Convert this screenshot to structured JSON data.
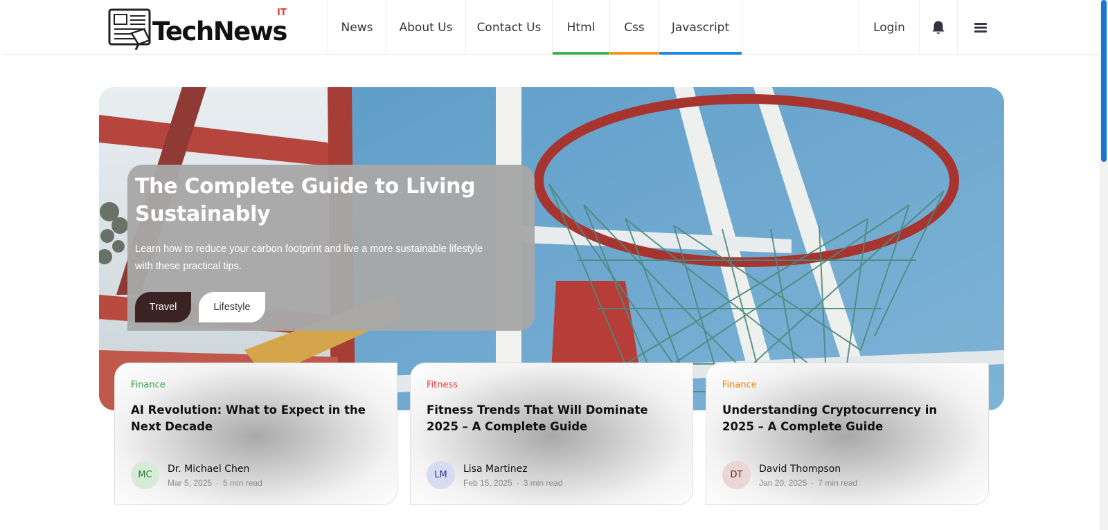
{
  "brand": {
    "name": "TechNews",
    "superscript": "IT"
  },
  "nav": {
    "items": [
      {
        "label": "News",
        "underline": ""
      },
      {
        "label": "About Us",
        "underline": ""
      },
      {
        "label": "Contact Us",
        "underline": ""
      },
      {
        "label": "Html",
        "underline": "#3bb54a"
      },
      {
        "label": "Css",
        "underline": "#f7941d"
      },
      {
        "label": "Javascript",
        "underline": "#1e88e5"
      }
    ],
    "login_label": "Login",
    "bell_icon": "bell-icon",
    "menu_icon": "hamburger-menu-icon"
  },
  "hero": {
    "title": "The Complete Guide to Living Sustainably",
    "description": "Learn how to reduce your carbon footprint and live a more sustainable lifestyle with these practical tips.",
    "tags": [
      "Travel",
      "Lifestyle"
    ],
    "image": "basketball-hoop-photo"
  },
  "cards": [
    {
      "category": "Finance",
      "category_color": "#2e9e45",
      "title": "AI Revolution: What to Expect in the Next Decade",
      "author": "Dr. Michael Chen",
      "initials": "MC",
      "avatar_bg": "#d6ecd9",
      "avatar_fg": "#2e7d32",
      "date": "Mar 5, 2025",
      "read_time": "5 min read"
    },
    {
      "category": "Fitness",
      "category_color": "#e53935",
      "title": "Fitness Trends That Will Dominate 2025 – A Complete Guide",
      "author": "Lisa Martinez",
      "initials": "LM",
      "avatar_bg": "#d7dcf3",
      "avatar_fg": "#283593",
      "date": "Feb 15, 2025",
      "read_time": "3 min read"
    },
    {
      "category": "Finance",
      "category_color": "#f57c00",
      "title": "Understanding Cryptocurrency in 2025 – A Complete Guide",
      "author": "David Thompson",
      "initials": "DT",
      "avatar_bg": "#ead6d6",
      "avatar_fg": "#5d2b2b",
      "date": "Jan 20, 2025",
      "read_time": "7 min read"
    }
  ],
  "colors": {
    "accent": "#1976d2"
  }
}
